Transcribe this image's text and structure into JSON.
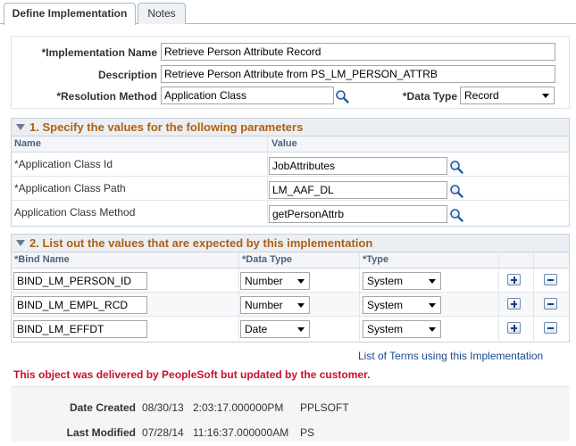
{
  "tabs": [
    {
      "label": "Define Implementation"
    },
    {
      "label": "Notes"
    }
  ],
  "header": {
    "implementation_name_label": "*Implementation Name",
    "implementation_name_value": "Retrieve Person Attribute Record",
    "description_label": "Description",
    "description_value": "Retrieve Person Attribute from PS_LM_PERSON_ATTRB",
    "resolution_method_label": "*Resolution Method",
    "resolution_method_value": "Application Class",
    "data_type_label": "*Data Type",
    "data_type_value": "Record"
  },
  "params_grid": {
    "title": "1. Specify the values for the following parameters",
    "col_name": "Name",
    "col_value": "Value",
    "rows": [
      {
        "name": "*Application Class Id",
        "value": "JobAttributes"
      },
      {
        "name": "*Application Class Path",
        "value": "LM_AAF_DL"
      },
      {
        "name": "Application Class Method",
        "value": "getPersonAttrb"
      }
    ]
  },
  "bind_grid": {
    "title": "2. List out the values that are expected by this implementation",
    "col_bind_name": "*Bind Name",
    "col_data_type": "*Data Type",
    "col_type": "*Type",
    "rows": [
      {
        "bind_name": "BIND_LM_PERSON_ID",
        "data_type": "Number",
        "type": "System"
      },
      {
        "bind_name": "BIND_LM_EMPL_RCD",
        "data_type": "Number",
        "type": "System"
      },
      {
        "bind_name": "BIND_LM_EFFDT",
        "data_type": "Date",
        "type": "System"
      }
    ]
  },
  "terms_link": "List of Terms using this Implementation",
  "warning": "This object was delivered by PeopleSoft but updated by the customer.",
  "audit": {
    "created_label": "Date Created",
    "created_date": "08/30/13",
    "created_time": "2:03:17.000000PM",
    "created_by": "PPLSOFT",
    "modified_label": "Last Modified",
    "modified_date": "07/28/14",
    "modified_time": "11:16:37.000000AM",
    "modified_by": "PS"
  },
  "colors": {
    "section_title": "#b05f0f",
    "warning": "#c8102e",
    "link": "#1a4b8c"
  }
}
